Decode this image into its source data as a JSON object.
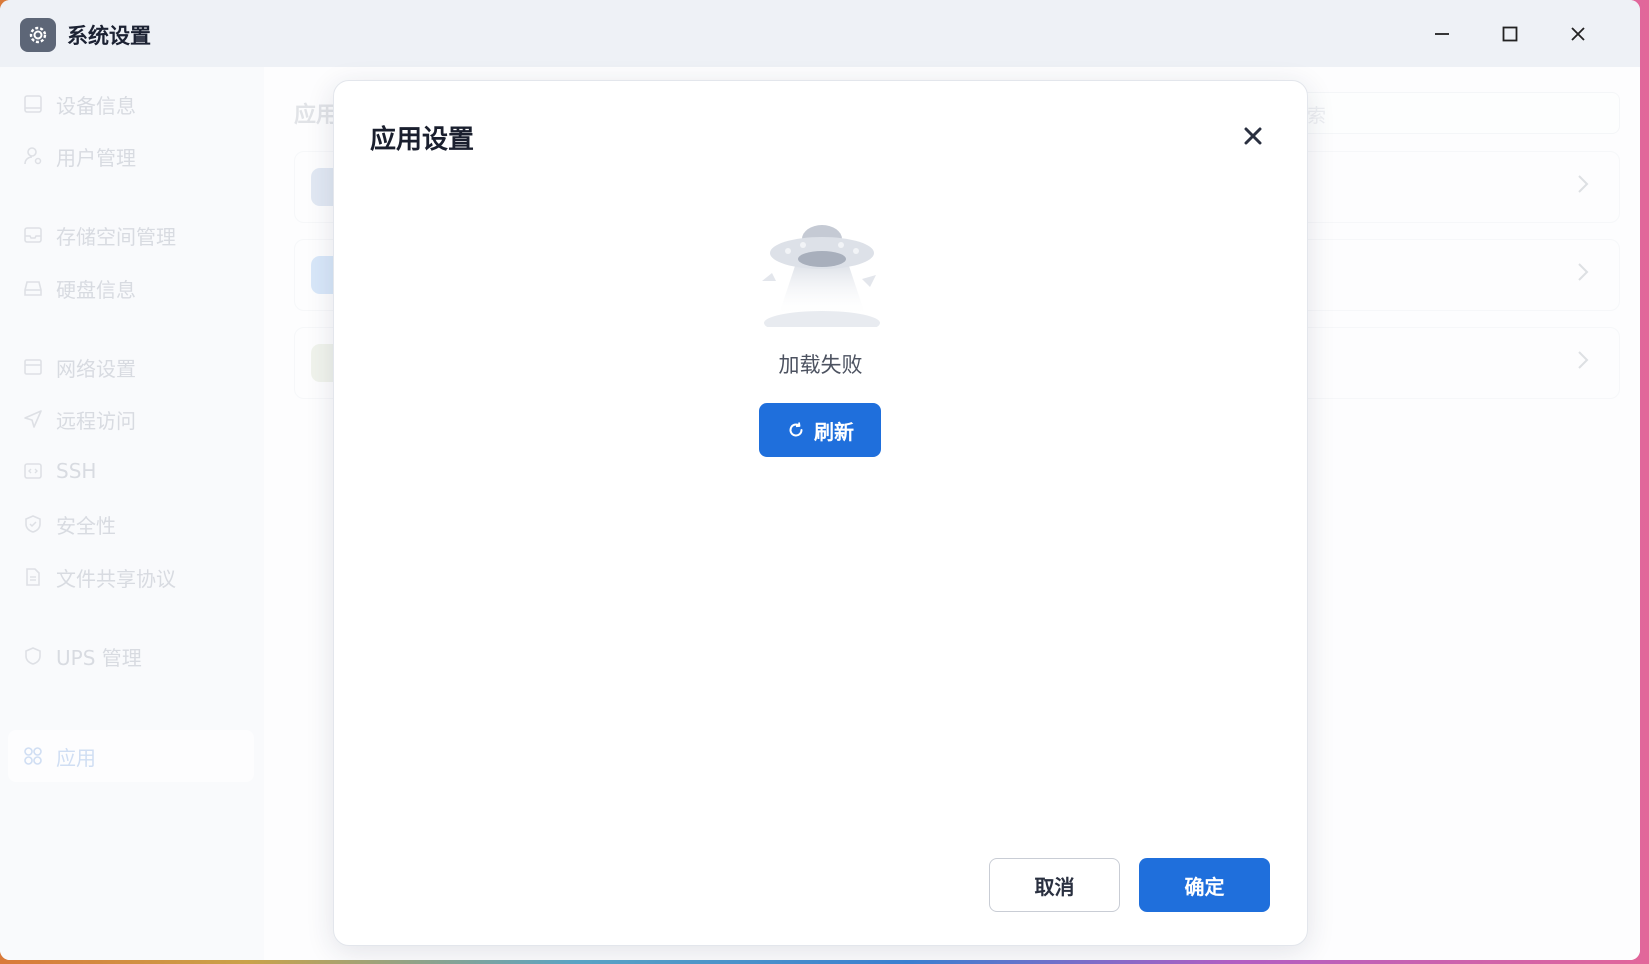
{
  "window": {
    "title": "系统设置",
    "controls": [
      "minimize",
      "maximize",
      "close"
    ]
  },
  "sidebar": {
    "items": [
      {
        "label": "设备信息",
        "icon": "monitor-icon"
      },
      {
        "label": "用户管理",
        "icon": "user-gear-icon"
      },
      {
        "label": "存储空间管理",
        "icon": "inbox-icon"
      },
      {
        "label": "硬盘信息",
        "icon": "hard-drive-icon"
      },
      {
        "label": "网络设置",
        "icon": "network-icon"
      },
      {
        "label": "远程访问",
        "icon": "send-icon"
      },
      {
        "label": "SSH",
        "icon": "code-icon"
      },
      {
        "label": "安全性",
        "icon": "shield-check-icon"
      },
      {
        "label": "文件共享协议",
        "icon": "file-icon"
      },
      {
        "label": "UPS 管理",
        "icon": "shield-icon"
      },
      {
        "label": "应用",
        "icon": "apps-icon",
        "active": true
      }
    ]
  },
  "main": {
    "title": "应用",
    "search_placeholder": "搜索",
    "search_visible_fragment": "索"
  },
  "dialog": {
    "title": "应用设置",
    "empty_text": "加载失败",
    "refresh_label": "刷新",
    "cancel_label": "取消",
    "ok_label": "确定"
  },
  "colors": {
    "primary": "#1f6fdc",
    "sidebar_active_text": "#a9c3ea"
  }
}
